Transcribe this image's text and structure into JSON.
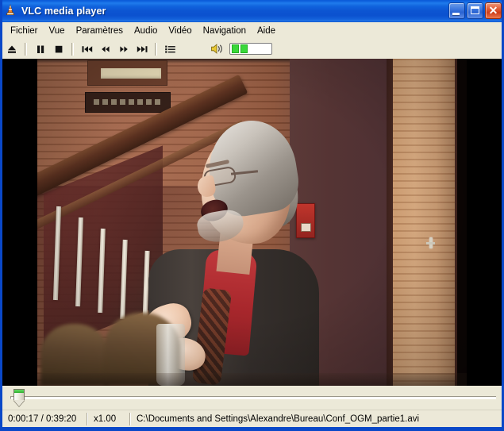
{
  "window": {
    "title": "VLC media player",
    "app_icon": "vlc-cone-icon",
    "controls": {
      "minimize": "minimize-button",
      "maximize": "maximize-button",
      "close": "close-button",
      "close_glyph": "✕"
    },
    "colors": {
      "titlebar_blue": "#0c55d2",
      "chrome_beige": "#ece9d8",
      "close_red": "#cf3d18",
      "volume_green": "#3ad83a",
      "slider_green": "#2fae2f"
    }
  },
  "menubar": {
    "items": [
      {
        "label": "Fichier",
        "name": "menu-fichier"
      },
      {
        "label": "Vue",
        "name": "menu-vue"
      },
      {
        "label": "Paramètres",
        "name": "menu-parametres"
      },
      {
        "label": "Audio",
        "name": "menu-audio"
      },
      {
        "label": "Vidéo",
        "name": "menu-video"
      },
      {
        "label": "Navigation",
        "name": "menu-navigation"
      },
      {
        "label": "Aide",
        "name": "menu-aide"
      }
    ]
  },
  "toolbar": {
    "buttons": [
      {
        "name": "eject-button",
        "icon": "eject-icon"
      },
      {
        "name": "pause-button",
        "icon": "pause-icon"
      },
      {
        "name": "stop-button",
        "icon": "stop-icon"
      },
      {
        "name": "previous-button",
        "icon": "skip-backward-icon"
      },
      {
        "name": "rewind-button",
        "icon": "rewind-icon"
      },
      {
        "name": "fast-forward-button",
        "icon": "fast-forward-icon"
      },
      {
        "name": "next-button",
        "icon": "skip-forward-icon"
      },
      {
        "name": "playlist-button",
        "icon": "playlist-icon"
      }
    ],
    "volume": {
      "icon": "speaker-icon",
      "segments_filled": 2,
      "segments_total": 5
    }
  },
  "video": {
    "letterbox_color": "#000000",
    "scene_description": "Conference speaker in front of brick wall with staircase",
    "aspect": "4:3 pillarboxed"
  },
  "seek": {
    "position_percent": 0.7,
    "thumb_name": "seek-slider-thumb"
  },
  "statusbar": {
    "time": "0:00:17 / 0:39:20",
    "elapsed": "0:00:17",
    "duration": "0:39:20",
    "rate": "x1.00",
    "file_path": "C:\\Documents and Settings\\Alexandre\\Bureau\\Conf_OGM_partie1.avi"
  }
}
